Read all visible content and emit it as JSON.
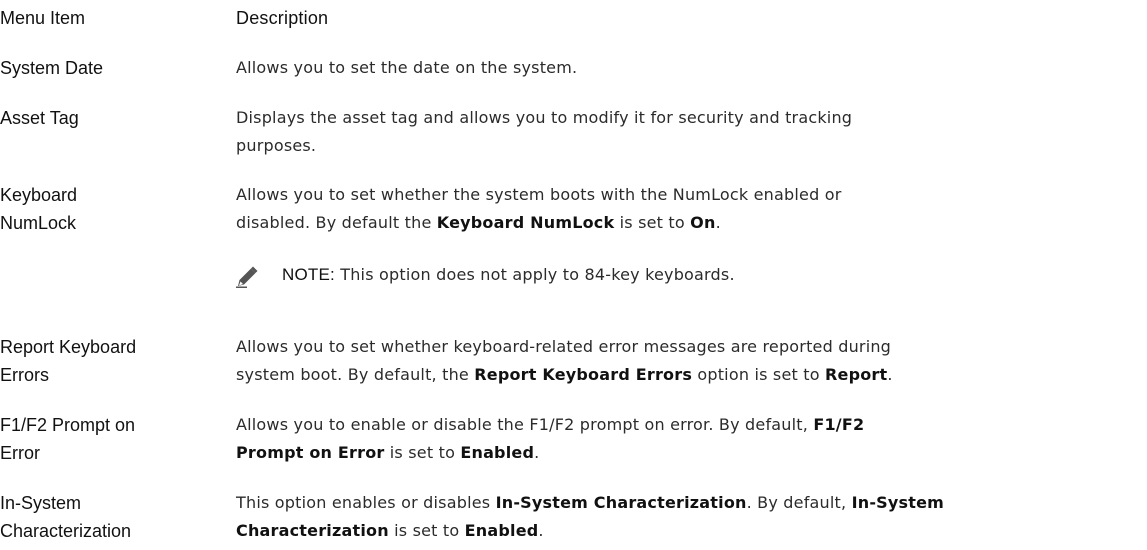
{
  "table": {
    "header": {
      "term": "Menu Item",
      "description": "Description"
    },
    "rows": [
      {
        "term": "System Date",
        "description": "Allows you to set the date on the system."
      },
      {
        "term": "Asset Tag",
        "description": "Displays the asset tag and allows you to modify it for security and tracking purposes."
      },
      {
        "term_line1": "Keyboard",
        "term_line2": "NumLock",
        "desc_line1": "Allows you to set whether the system boots with the NumLock enabled or",
        "desc_a": "disabled. By default the ",
        "desc_b": "Keyboard NumLock",
        "desc_c": " is set to ",
        "desc_d": "On",
        "desc_e": ".",
        "note_label": "NOTE:",
        "note_text": " This option does not apply to 84-key keyboards.",
        "note_icon": "pencil-note-icon"
      },
      {
        "term_line1": "Report Keyboard",
        "term_line2": "Errors",
        "desc_line1": "Allows you to set whether keyboard-related error messages are reported during",
        "desc_a": "system boot. By default, the ",
        "desc_b": "Report Keyboard Errors",
        "desc_c": " option is set to ",
        "desc_d": "Report",
        "desc_e": "."
      },
      {
        "term_line1": "F1/F2 Prompt on",
        "term_line2": "Error",
        "desc_a": "Allows you to enable or disable the F1/F2 prompt on error. By default, ",
        "desc_b": "F1/F2",
        "desc_c": "Prompt on Error",
        "desc_d": " is set to ",
        "desc_e": "Enabled",
        "desc_f": "."
      },
      {
        "term_line1": "In-System",
        "term_line2": "Characterization",
        "desc_a": "This option enables or disables ",
        "desc_b": "In-System Characterization",
        "desc_c": ". By default, ",
        "desc_d": "In-System",
        "desc_e": "Characterization",
        "desc_f": " is set to ",
        "desc_g": "Enabled",
        "desc_h": "."
      }
    ]
  }
}
